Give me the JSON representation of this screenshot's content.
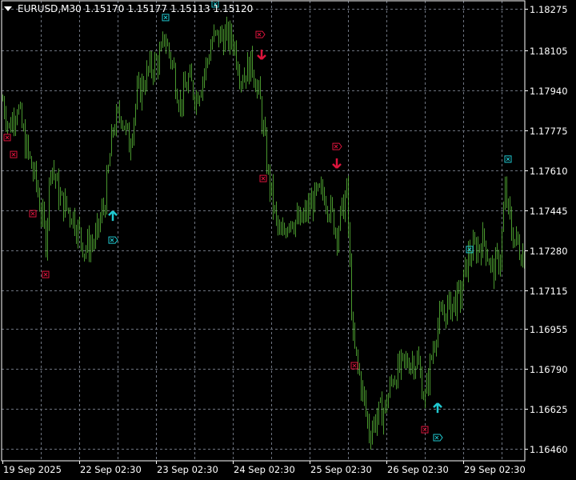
{
  "header": {
    "symbol": "EURUSD,M30",
    "open": "1.15170",
    "high": "1.15177",
    "low": "1.15113",
    "close": "1.15120"
  },
  "colors": {
    "bars": "#5cbf3a",
    "sell": "#dc143c",
    "buy": "#20c8d0",
    "grid": "#6e7480",
    "axis": "#ffffff"
  },
  "chart_data": {
    "type": "bar",
    "title": "EURUSD,M30",
    "price_ticks": [
      "1.18275",
      "1.18105",
      "1.17940",
      "1.17775",
      "1.17610",
      "1.17445",
      "1.17280",
      "1.17115",
      "1.16955",
      "1.16790",
      "1.16625",
      "1.16460"
    ],
    "time_ticks": [
      "19 Sep 2025",
      "22 Sep 02:30",
      "23 Sep 02:30",
      "24 Sep 02:30",
      "25 Sep 02:30",
      "26 Sep 02:30",
      "29 Sep 02:30"
    ],
    "ylim": [
      1.164,
      1.1832
    ],
    "bars_per_time_tick": 48,
    "price_path": [
      [
        0,
        1.17899
      ],
      [
        4,
        1.17783
      ],
      [
        9,
        1.17882
      ],
      [
        14,
        1.17717
      ],
      [
        21,
        1.17552
      ],
      [
        27,
        1.17321
      ],
      [
        30,
        1.17651
      ],
      [
        36,
        1.17486
      ],
      [
        44,
        1.1742
      ],
      [
        51,
        1.17288
      ],
      [
        58,
        1.17321
      ],
      [
        64,
        1.17486
      ],
      [
        69,
        1.17783
      ],
      [
        74,
        1.17849
      ],
      [
        79,
        1.17717
      ],
      [
        84,
        1.17915
      ],
      [
        91,
        1.18014
      ],
      [
        99,
        1.1808
      ],
      [
        101,
        1.18163
      ],
      [
        106,
        1.18047
      ],
      [
        111,
        1.17882
      ],
      [
        116,
        1.17981
      ],
      [
        121,
        1.17915
      ],
      [
        126,
        1.18014
      ],
      [
        131,
        1.18146
      ],
      [
        136,
        1.18163
      ],
      [
        144,
        1.18146
      ],
      [
        149,
        1.17998
      ],
      [
        156,
        1.18047
      ],
      [
        161,
        1.17882
      ],
      [
        166,
        1.17585
      ],
      [
        171,
        1.17387
      ],
      [
        174,
        1.17321
      ],
      [
        179,
        1.1742
      ],
      [
        186,
        1.17387
      ],
      [
        194,
        1.17486
      ],
      [
        201,
        1.17519
      ],
      [
        209,
        1.17354
      ],
      [
        215,
        1.17519
      ],
      [
        219,
        1.16892
      ],
      [
        224,
        1.16727
      ],
      [
        229,
        1.16529
      ],
      [
        234,
        1.16595
      ],
      [
        239,
        1.16628
      ],
      [
        244,
        1.1676
      ],
      [
        249,
        1.16793
      ],
      [
        254,
        1.16826
      ],
      [
        259,
        1.16826
      ],
      [
        264,
        1.16661
      ],
      [
        266,
        1.1676
      ],
      [
        271,
        1.16958
      ],
      [
        276,
        1.17024
      ],
      [
        281,
        1.17057
      ],
      [
        286,
        1.1709
      ],
      [
        291,
        1.17255
      ],
      [
        296,
        1.17288
      ],
      [
        301,
        1.17321
      ],
      [
        306,
        1.17189
      ],
      [
        311,
        1.17255
      ],
      [
        314,
        1.17519
      ],
      [
        318,
        1.17354
      ],
      [
        323,
        1.17288
      ],
      [
        326,
        1.17255
      ]
    ],
    "markers": [
      {
        "type": "sell-close",
        "bar": 3,
        "price": 1.17744
      },
      {
        "type": "sell-close",
        "bar": 7,
        "price": 1.17674
      },
      {
        "type": "sell-close",
        "bar": 19,
        "price": 1.1743
      },
      {
        "type": "sell-close",
        "bar": 27,
        "price": 1.17179
      },
      {
        "type": "sell-close",
        "bar": 163,
        "price": 1.17575
      },
      {
        "type": "sell-close",
        "bar": 220,
        "price": 1.16803
      },
      {
        "type": "sell-close",
        "bar": 264,
        "price": 1.16539
      },
      {
        "type": "sell-flag",
        "bar": 161,
        "price": 1.18169
      },
      {
        "type": "sell-flag",
        "bar": 209,
        "price": 1.17707
      },
      {
        "type": "sell-arrow",
        "bar": 162,
        "price": 1.18087
      },
      {
        "type": "sell-arrow",
        "bar": 209,
        "price": 1.17638
      },
      {
        "type": "buy-arrow",
        "bar": 69,
        "price": 1.1742
      },
      {
        "type": "buy-arrow",
        "bar": 272,
        "price": 1.16628
      },
      {
        "type": "buy-close",
        "bar": 102,
        "price": 1.18239
      },
      {
        "type": "buy-close",
        "bar": 133,
        "price": 1.18295
      },
      {
        "type": "buy-close",
        "bar": 316,
        "price": 1.17655
      },
      {
        "type": "buy-close",
        "bar": 292,
        "price": 1.17282
      },
      {
        "type": "buy-flag",
        "bar": 69,
        "price": 1.17321
      },
      {
        "type": "buy-flag",
        "bar": 272,
        "price": 1.16506
      }
    ]
  }
}
